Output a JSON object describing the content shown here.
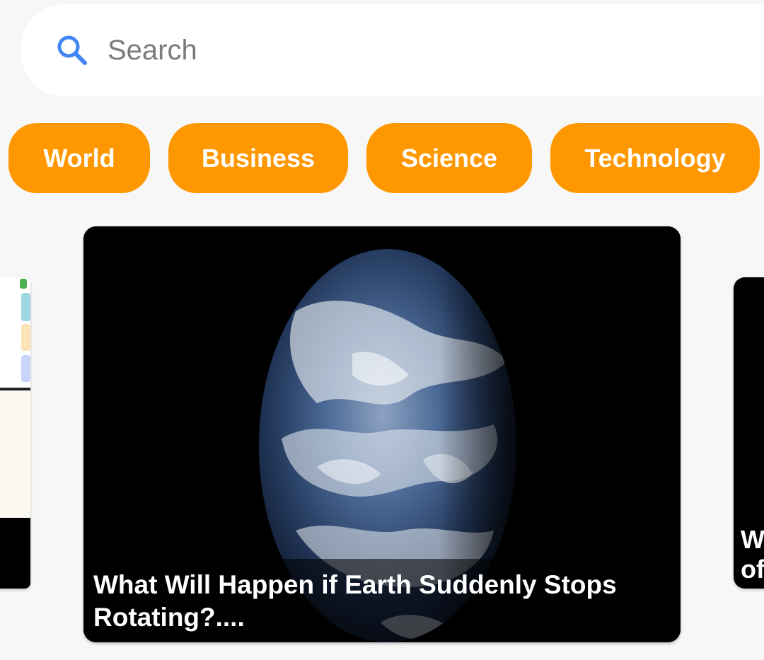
{
  "search": {
    "placeholder": "Search",
    "icon": "search-icon",
    "icon_color": "#4285f4"
  },
  "categories": [
    {
      "label": "World"
    },
    {
      "label": "Business"
    },
    {
      "label": "Science"
    },
    {
      "label": "Technology"
    }
  ],
  "accent_color": "#ff9800",
  "carousel": {
    "main_card": {
      "title": "What Will Happen if Earth Suddenly Stops Rotating?....",
      "image": "earth-from-space"
    },
    "right_card": {
      "title_fragment": "W\nof"
    }
  }
}
